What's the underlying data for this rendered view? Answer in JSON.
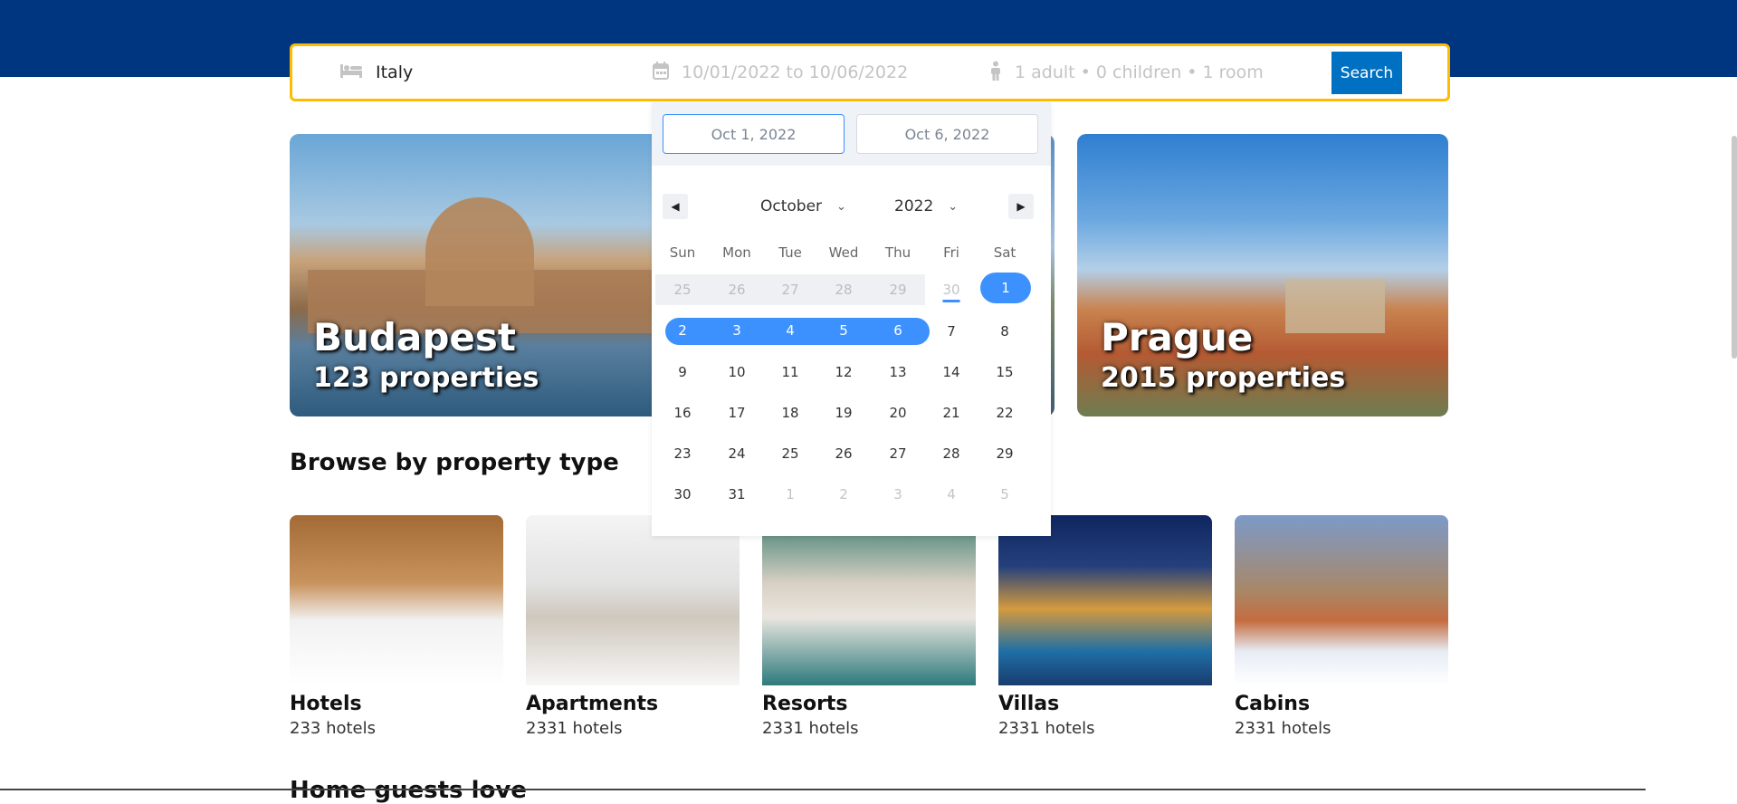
{
  "search": {
    "destination": "Italy",
    "dates": "10/01/2022 to 10/06/2022",
    "guests": "1 adult • 0 children • 1 room",
    "search_label": "Search",
    "bed_icon": "bed-icon",
    "calendar_icon": "calendar-icon",
    "person_icon": "person-icon"
  },
  "cities": [
    {
      "name": "Budapest",
      "count": "123 properties"
    },
    {
      "name": "Prague",
      "count": "2015 properties"
    }
  ],
  "section_title": "Browse by property type",
  "property_types": [
    {
      "name": "Hotels",
      "count": "233 hotels"
    },
    {
      "name": "Apartments",
      "count": "2331 hotels"
    },
    {
      "name": "Resorts",
      "count": "2331 hotels"
    },
    {
      "name": "Villas",
      "count": "2331 hotels"
    },
    {
      "name": "Cabins",
      "count": "2331 hotels"
    }
  ],
  "next_section_title": "Home guests love",
  "datepicker": {
    "start_date": "Oct 1, 2022",
    "end_date": "Oct 6, 2022",
    "month": "October",
    "year": "2022",
    "weekdays": [
      "Sun",
      "Mon",
      "Tue",
      "Wed",
      "Thu",
      "Fri",
      "Sat"
    ],
    "weeks": [
      [
        "25",
        "26",
        "27",
        "28",
        "29",
        "30",
        "1"
      ],
      [
        "2",
        "3",
        "4",
        "5",
        "6",
        "7",
        "8"
      ],
      [
        "9",
        "10",
        "11",
        "12",
        "13",
        "14",
        "15"
      ],
      [
        "16",
        "17",
        "18",
        "19",
        "20",
        "21",
        "22"
      ],
      [
        "23",
        "24",
        "25",
        "26",
        "27",
        "28",
        "29"
      ],
      [
        "30",
        "31",
        "1",
        "2",
        "3",
        "4",
        "5"
      ]
    ],
    "accent_color": "#3d91ff"
  },
  "colors": {
    "header": "#003580",
    "search_border": "#febb02",
    "search_button": "#0071c2"
  }
}
